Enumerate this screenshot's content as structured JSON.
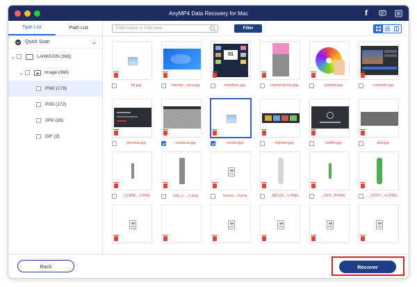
{
  "window": {
    "title": "AnyMP4 Data Recovery for Mac"
  },
  "titlebar_icons": [
    "facebook-icon",
    "feedback-icon",
    "menu-icon"
  ],
  "sidebar": {
    "tabs": [
      {
        "label": "Type List",
        "active": true
      },
      {
        "label": "Path List",
        "active": false
      }
    ],
    "scan_label": "Quick Scan",
    "tree": {
      "drive": "LANKEXIN (368)",
      "image": "Image (368)",
      "types": [
        "PNG (178)",
        "PSD (172)",
        "JPG (16)",
        "GIF (2)"
      ]
    }
  },
  "toolbar": {
    "search_placeholder": "Enter Name or Path here",
    "filter_label": "Filter"
  },
  "grid": {
    "files": [
      {
        "name": "bli.jpg",
        "checked": false
      },
      {
        "name": "interfac...vice.jpg",
        "checked": false
      },
      {
        "name": "interface.jpg",
        "checked": false
      },
      {
        "name": "import-photo.jpg",
        "checked": false
      },
      {
        "name": "playlist.jpg",
        "checked": false
      },
      {
        "name": "convertir.jpg",
        "checked": false
      },
      {
        "name": "general.jpg",
        "checked": false
      },
      {
        "name": "contacts.jpg",
        "checked": true
      },
      {
        "name": "media.jpg",
        "checked": true
      },
      {
        "name": "register.jpg",
        "checked": false
      },
      {
        "name": "toolkit.jpg",
        "checked": false
      },
      {
        "name": "dvd.jpg",
        "checked": false
      },
      {
        "name": "_COMB...1.PNG",
        "checked": false
      },
      {
        "name": "edit_c..._h.png",
        "checked": false
      },
      {
        "name": "mouse...d.png",
        "checked": false
      },
      {
        "name": "_MOUS...1.PNG",
        "checked": false
      },
      {
        "name": "_OPY_P.PNG",
        "checked": false
      },
      {
        "name": "_COPY_=1.PNG",
        "checked": false
      },
      {
        "name": "",
        "checked": false
      },
      {
        "name": "",
        "checked": false
      },
      {
        "name": "",
        "checked": false
      },
      {
        "name": "",
        "checked": false
      },
      {
        "name": "",
        "checked": false
      },
      {
        "name": "",
        "checked": false
      }
    ],
    "file_icon_label": "PNG"
  },
  "footer": {
    "back_label": "Back",
    "recover_label": "Recover"
  },
  "colors": {
    "titlebar": "#1d2b5e",
    "accent": "#2d6cdf",
    "button": "#1d3e86",
    "filename": "#e0453a",
    "highlight": "#e11e1e"
  }
}
